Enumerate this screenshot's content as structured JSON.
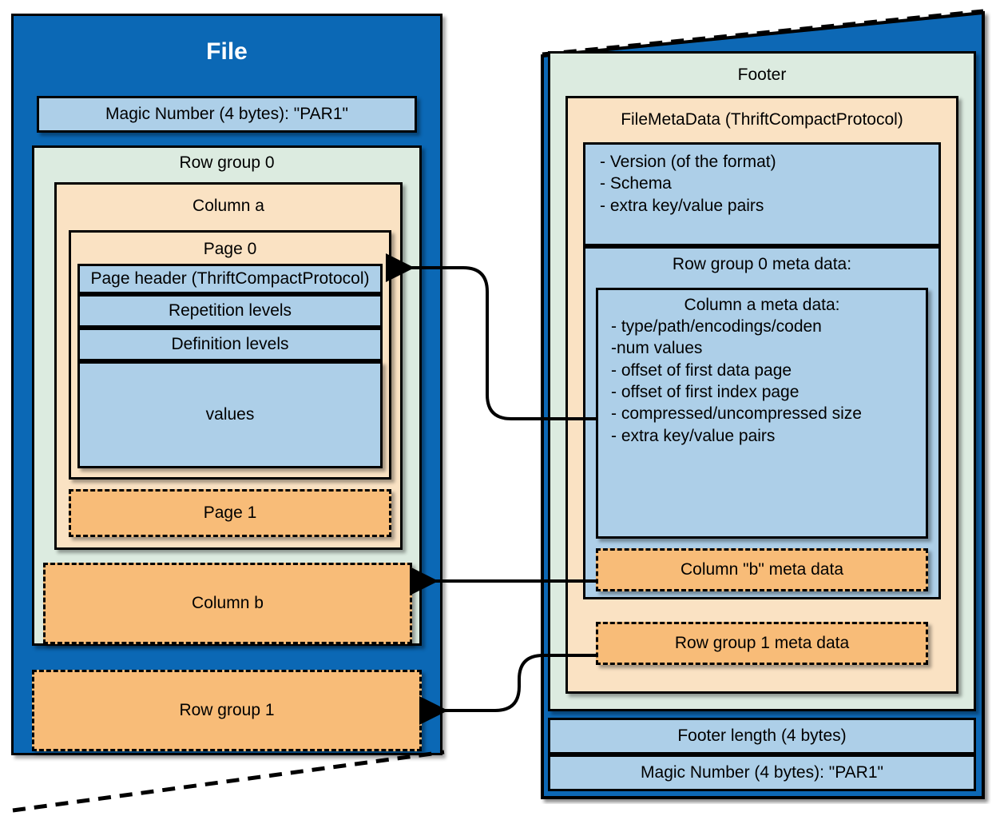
{
  "diagram": {
    "title": "Parquet file format layout",
    "colors": {
      "file_blue": "#0B68B5",
      "mint": "#DCEBE0",
      "peach": "#FAE2C3",
      "orange": "#F8BC78",
      "light_blue": "#ADCFE8",
      "outline": "#000000"
    }
  },
  "file_panel": {
    "title": "File",
    "magic_number": "Magic Number (4 bytes): \"PAR1\"",
    "row_group_0": {
      "label": "Row group 0",
      "column_a": {
        "label": "Column a",
        "page_0": {
          "label": "Page 0",
          "parts": [
            "Page header (ThriftCompactProtocol)",
            "Repetition levels",
            "Definition levels",
            "values"
          ]
        },
        "page_1": "Page 1"
      },
      "column_b": "Column b"
    },
    "row_group_1": "Row group 1"
  },
  "footer_panel": {
    "title": "Footer",
    "file_metadata": {
      "label": "FileMetaData (ThriftCompactProtocol)",
      "summary": "- Version (of the format)\n- Schema\n- extra key/value pairs",
      "row_group_0_meta": {
        "label": "Row group 0 meta data:",
        "column_a_meta": {
          "heading": "Column a meta data:",
          "items": "- type/path/encodings/coden\n-num values\n- offset of first data page\n- offset of first index page\n- compressed/uncompressed size\n- extra key/value pairs"
        },
        "column_b_meta": "Column \"b\" meta data"
      },
      "row_group_1_meta": "Row group 1 meta data"
    },
    "footer_length": "Footer length (4 bytes)",
    "magic_number": "Magic Number (4 bytes): \"PAR1\""
  },
  "connectors": [
    {
      "name": "column-a-meta-to-page-header"
    },
    {
      "name": "column-b-meta-to-column-b"
    },
    {
      "name": "row-group-1-meta-to-row-group-1"
    }
  ]
}
